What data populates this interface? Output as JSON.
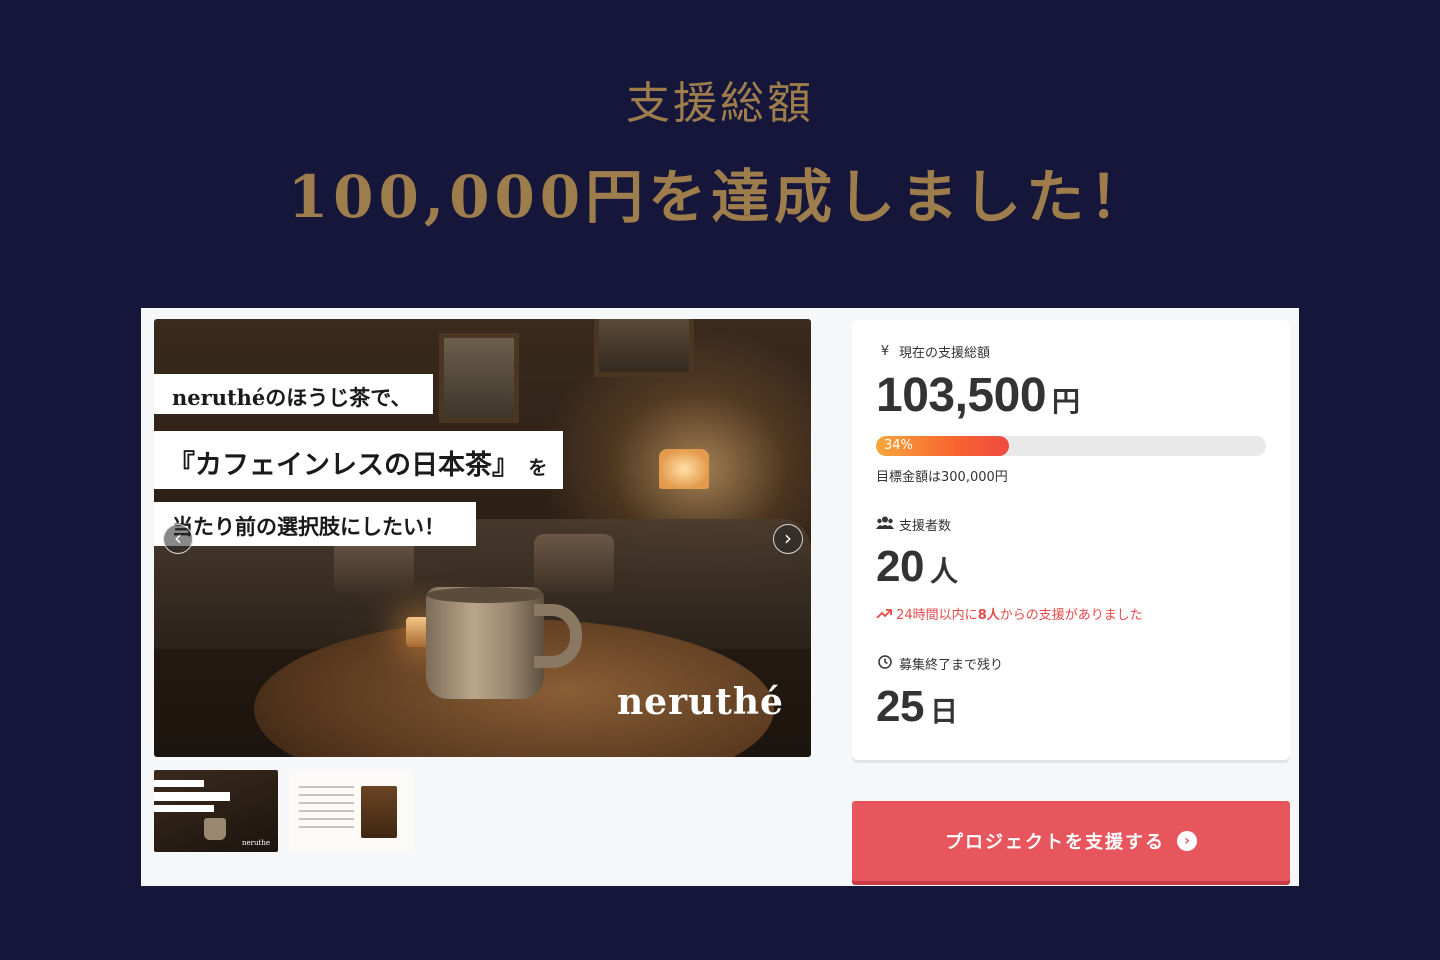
{
  "header": {
    "subtitle": "支援総額",
    "title": "100,000円を達成しました！"
  },
  "gallery": {
    "hero_lines": {
      "line1": "neruthéのほうじ茶で、",
      "line2": "『カフェインレスの日本茶』",
      "line2_suffix": "を",
      "line3": "当たり前の選択肢にしたい！"
    },
    "brand": "neruthé",
    "prev_icon": "chevron-left-icon",
    "next_icon": "chevron-right-icon",
    "prev_glyph": "‹",
    "next_glyph": "›",
    "thumb1_brand": "neruthe"
  },
  "stats": {
    "amount_label": "現在の支援総額",
    "amount_icon": "yen-icon",
    "amount_glyph": "¥",
    "amount_value": "103,500",
    "amount_unit": "円",
    "progress_percent": 34,
    "progress_label": "34%",
    "goal_text": "目標金額は300,000円",
    "supporters_label": "支援者数",
    "supporters_icon": "users-icon",
    "supporters_value": "20",
    "supporters_unit": "人",
    "recent_prefix": "24時間以内に",
    "recent_count": "8人",
    "recent_suffix": "からの支援がありました",
    "recent_icon": "trending-up-icon",
    "remaining_label": "募集終了まで残り",
    "remaining_icon": "clock-icon",
    "remaining_value": "25",
    "remaining_unit": "日"
  },
  "cta": {
    "label": "プロジェクトを支援する",
    "icon": "arrow-circle-right-icon",
    "glyph": "›"
  },
  "colors": {
    "background": "#15163a",
    "gold": "#9e7d4c",
    "cta": "#e8565d",
    "alert": "#e84a4a"
  }
}
